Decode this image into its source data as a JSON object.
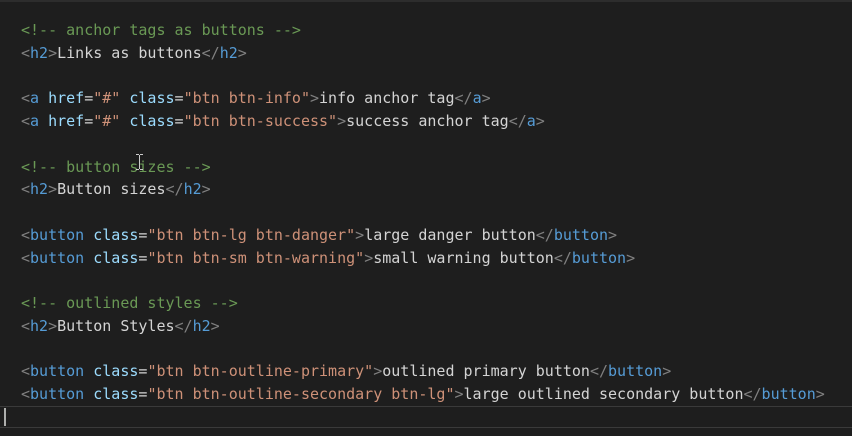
{
  "lines": [
    {
      "tokens": [
        {
          "t": "<!-- anchor tags as buttons -->",
          "c": "comment"
        }
      ]
    },
    {
      "tokens": [
        {
          "t": "<",
          "c": "punct"
        },
        {
          "t": "h2",
          "c": "tag"
        },
        {
          "t": ">",
          "c": "punct"
        },
        {
          "t": "Links as buttons",
          "c": "text"
        },
        {
          "t": "</",
          "c": "punct"
        },
        {
          "t": "h2",
          "c": "tag"
        },
        {
          "t": ">",
          "c": "punct"
        }
      ]
    },
    {
      "tokens": []
    },
    {
      "tokens": [
        {
          "t": "<",
          "c": "punct"
        },
        {
          "t": "a",
          "c": "tag"
        },
        {
          "t": " ",
          "c": "text"
        },
        {
          "t": "href",
          "c": "attr"
        },
        {
          "t": "=",
          "c": "text"
        },
        {
          "t": "\"#\"",
          "c": "str"
        },
        {
          "t": " ",
          "c": "text"
        },
        {
          "t": "class",
          "c": "attr"
        },
        {
          "t": "=",
          "c": "text"
        },
        {
          "t": "\"btn btn-info\"",
          "c": "str"
        },
        {
          "t": ">",
          "c": "punct"
        },
        {
          "t": "info anchor tag",
          "c": "text"
        },
        {
          "t": "</",
          "c": "punct"
        },
        {
          "t": "a",
          "c": "tag"
        },
        {
          "t": ">",
          "c": "punct"
        }
      ]
    },
    {
      "tokens": [
        {
          "t": "<",
          "c": "punct"
        },
        {
          "t": "a",
          "c": "tag"
        },
        {
          "t": " ",
          "c": "text"
        },
        {
          "t": "href",
          "c": "attr"
        },
        {
          "t": "=",
          "c": "text"
        },
        {
          "t": "\"#\"",
          "c": "str"
        },
        {
          "t": " ",
          "c": "text"
        },
        {
          "t": "class",
          "c": "attr"
        },
        {
          "t": "=",
          "c": "text"
        },
        {
          "t": "\"btn btn-success\"",
          "c": "str"
        },
        {
          "t": ">",
          "c": "punct"
        },
        {
          "t": "success anchor tag",
          "c": "text"
        },
        {
          "t": "</",
          "c": "punct"
        },
        {
          "t": "a",
          "c": "tag"
        },
        {
          "t": ">",
          "c": "punct"
        }
      ]
    },
    {
      "tokens": []
    },
    {
      "tokens": [
        {
          "t": "<!-- button sizes -->",
          "c": "comment"
        }
      ]
    },
    {
      "tokens": [
        {
          "t": "<",
          "c": "punct"
        },
        {
          "t": "h2",
          "c": "tag"
        },
        {
          "t": ">",
          "c": "punct"
        },
        {
          "t": "Button sizes",
          "c": "text"
        },
        {
          "t": "</",
          "c": "punct"
        },
        {
          "t": "h2",
          "c": "tag"
        },
        {
          "t": ">",
          "c": "punct"
        }
      ]
    },
    {
      "tokens": []
    },
    {
      "tokens": [
        {
          "t": "<",
          "c": "punct"
        },
        {
          "t": "button",
          "c": "tag"
        },
        {
          "t": " ",
          "c": "text"
        },
        {
          "t": "class",
          "c": "attr"
        },
        {
          "t": "=",
          "c": "text"
        },
        {
          "t": "\"btn btn-lg btn-danger\"",
          "c": "str"
        },
        {
          "t": ">",
          "c": "punct"
        },
        {
          "t": "large danger button",
          "c": "text"
        },
        {
          "t": "</",
          "c": "punct"
        },
        {
          "t": "button",
          "c": "tag"
        },
        {
          "t": ">",
          "c": "punct"
        }
      ]
    },
    {
      "tokens": [
        {
          "t": "<",
          "c": "punct"
        },
        {
          "t": "button",
          "c": "tag"
        },
        {
          "t": " ",
          "c": "text"
        },
        {
          "t": "class",
          "c": "attr"
        },
        {
          "t": "=",
          "c": "text"
        },
        {
          "t": "\"btn btn-sm btn-warning\"",
          "c": "str"
        },
        {
          "t": ">",
          "c": "punct"
        },
        {
          "t": "small warning button",
          "c": "text"
        },
        {
          "t": "</",
          "c": "punct"
        },
        {
          "t": "button",
          "c": "tag"
        },
        {
          "t": ">",
          "c": "punct"
        }
      ]
    },
    {
      "tokens": []
    },
    {
      "tokens": [
        {
          "t": "<!-- outlined styles -->",
          "c": "comment"
        }
      ]
    },
    {
      "tokens": [
        {
          "t": "<",
          "c": "punct"
        },
        {
          "t": "h2",
          "c": "tag"
        },
        {
          "t": ">",
          "c": "punct"
        },
        {
          "t": "Button Styles",
          "c": "text"
        },
        {
          "t": "</",
          "c": "punct"
        },
        {
          "t": "h2",
          "c": "tag"
        },
        {
          "t": ">",
          "c": "punct"
        }
      ]
    },
    {
      "tokens": []
    },
    {
      "tokens": [
        {
          "t": "<",
          "c": "punct"
        },
        {
          "t": "button",
          "c": "tag"
        },
        {
          "t": " ",
          "c": "text"
        },
        {
          "t": "class",
          "c": "attr"
        },
        {
          "t": "=",
          "c": "text"
        },
        {
          "t": "\"btn btn-outline-primary\"",
          "c": "str"
        },
        {
          "t": ">",
          "c": "punct"
        },
        {
          "t": "outlined primary button",
          "c": "text"
        },
        {
          "t": "</",
          "c": "punct"
        },
        {
          "t": "button",
          "c": "tag"
        },
        {
          "t": ">",
          "c": "punct"
        }
      ]
    },
    {
      "tokens": [
        {
          "t": "<",
          "c": "punct"
        },
        {
          "t": "button",
          "c": "tag"
        },
        {
          "t": " ",
          "c": "text"
        },
        {
          "t": "class",
          "c": "attr"
        },
        {
          "t": "=",
          "c": "text"
        },
        {
          "t": "\"btn btn-outline-secondary btn-lg\"",
          "c": "str"
        },
        {
          "t": ">",
          "c": "punct"
        },
        {
          "t": "large outlined secondary button",
          "c": "text"
        },
        {
          "t": "</",
          "c": "punct"
        },
        {
          "t": "button",
          "c": "tag"
        },
        {
          "t": ">",
          "c": "punct"
        }
      ]
    }
  ],
  "colors": {
    "background": "#1e1e1e",
    "comment": "#6a9955",
    "tag": "#569cd6",
    "punct": "#808080",
    "attr": "#9cdcfe",
    "string": "#ce9178",
    "text": "#d4d4d4"
  }
}
